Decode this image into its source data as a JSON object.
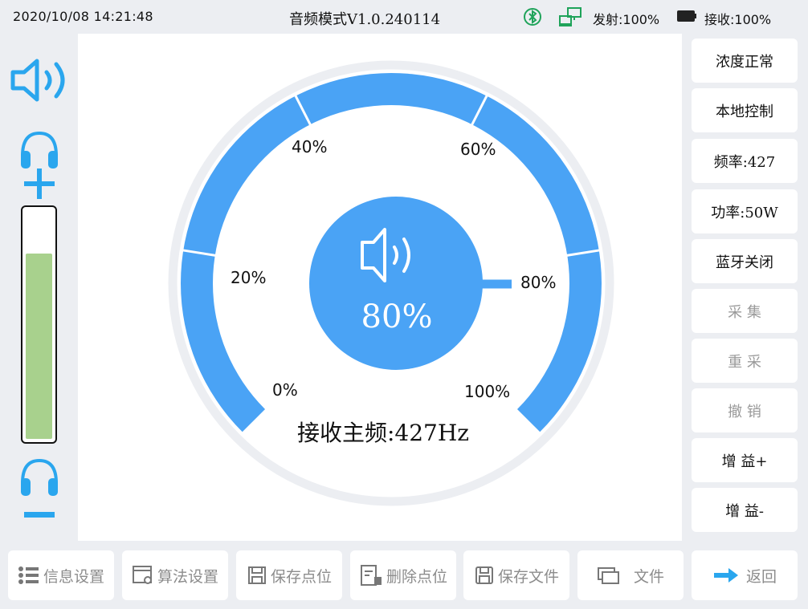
{
  "status": {
    "datetime": "2020/10/08 14:21:48",
    "mode_title": "音频模式V1.0.240114",
    "tx_label": "发射:100%",
    "rx_label": "接收:100%",
    "bluetooth_color": "#1fa35a",
    "network_color": "#1fa35a"
  },
  "left": {
    "level": 0.81,
    "level_color": "#a8d18d",
    "icons": [
      "speaker-icon",
      "headphones-plus-icon",
      "headphones-minus-icon"
    ]
  },
  "gauge": {
    "value_label": "80%",
    "value_fraction": 0.8,
    "ticks": [
      "0%",
      "20%",
      "40%",
      "60%",
      "80%",
      "100%"
    ],
    "freq_line": "接收主频:427Hz",
    "accent": "#4aa3f5"
  },
  "side_buttons": [
    {
      "label": "浓度正常",
      "enabled": true
    },
    {
      "label": "本地控制",
      "enabled": true
    },
    {
      "label": "频率:427",
      "enabled": true
    },
    {
      "label": "功率:50W",
      "enabled": true
    },
    {
      "label": "蓝牙关闭",
      "enabled": true
    },
    {
      "label": "采 集",
      "enabled": false
    },
    {
      "label": "重 采",
      "enabled": false
    },
    {
      "label": "撤 销",
      "enabled": false
    },
    {
      "label": "增 益+",
      "enabled": true
    },
    {
      "label": "增 益-",
      "enabled": true
    }
  ],
  "bottom_buttons": [
    {
      "label": "信息设置",
      "icon": "list-icon"
    },
    {
      "label": "算法设置",
      "icon": "window-gear-icon"
    },
    {
      "label": "保存点位",
      "icon": "save-icon"
    },
    {
      "label": "删除点位",
      "icon": "delete-doc-icon"
    },
    {
      "label": "保存文件",
      "icon": "save-file-icon"
    },
    {
      "label": "文件",
      "icon": "folder-icon"
    },
    {
      "label": "返回",
      "icon": "arrow-right-icon"
    }
  ]
}
